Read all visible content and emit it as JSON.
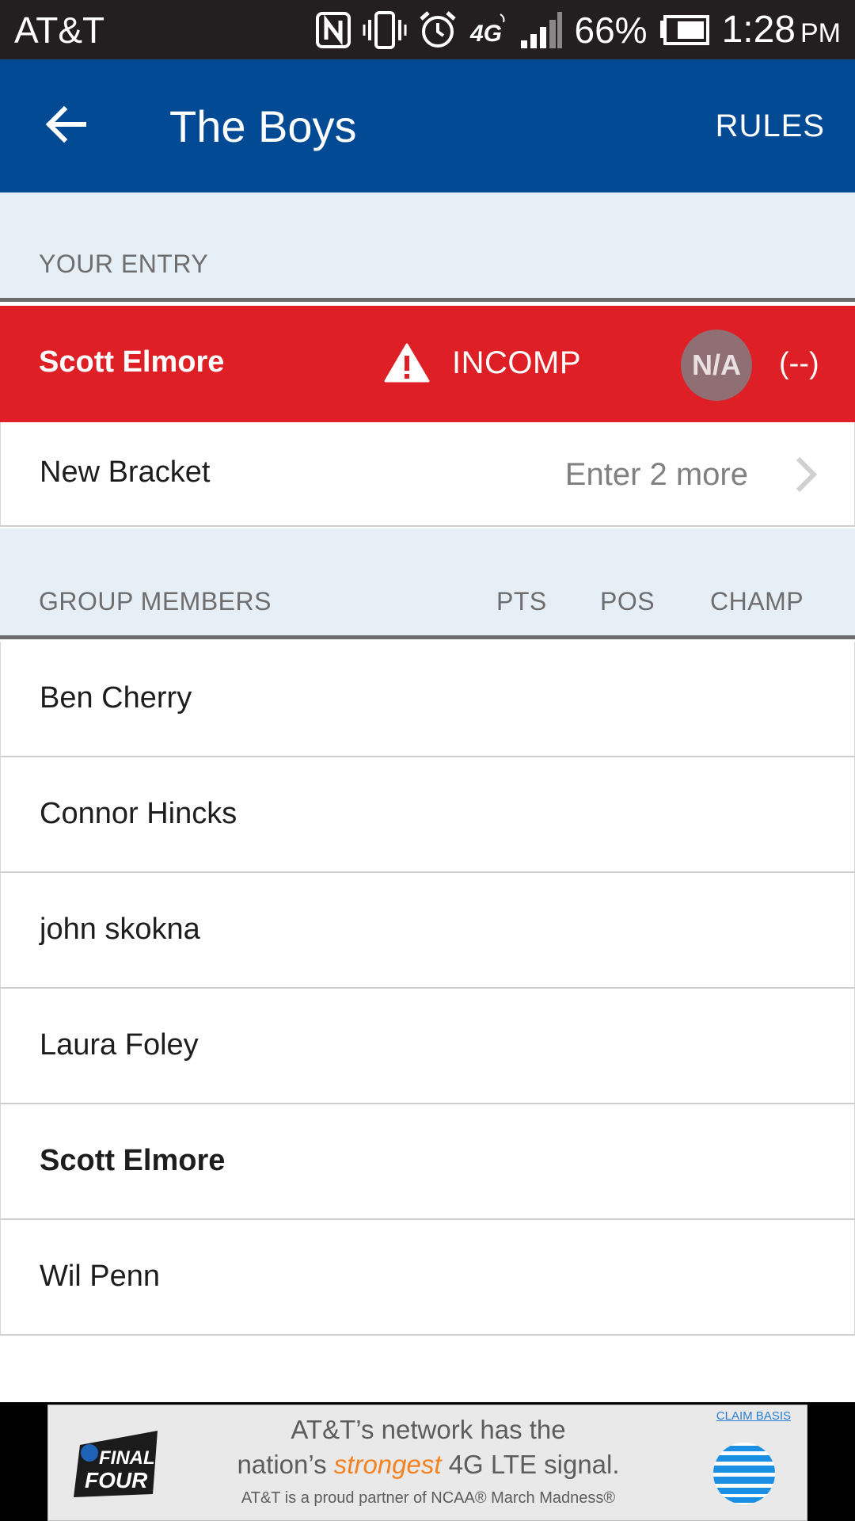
{
  "status_bar": {
    "carrier": "AT&T",
    "network": "4G",
    "battery": "66%",
    "time": "1:28",
    "ampm": "PM"
  },
  "app_bar": {
    "title": "The Boys",
    "rules_label": "RULES"
  },
  "your_entry": {
    "section_label": "YOUR ENTRY",
    "name": "Scott Elmore",
    "status": "INCOMP",
    "badge": "N/A",
    "rank": "(--)",
    "bracket_label": "New Bracket",
    "bracket_cta": "Enter 2 more",
    "colors": {
      "row_bg": "#df1f26",
      "badge_bg": "#8f6f73"
    }
  },
  "group_members": {
    "section_label": "GROUP MEMBERS",
    "columns": [
      "PTS",
      "POS",
      "CHAMP"
    ],
    "members": [
      {
        "name": "Ben Cherry"
      },
      {
        "name": "Connor Hincks"
      },
      {
        "name": "john skokna"
      },
      {
        "name": "Laura Foley"
      },
      {
        "name": "Scott Elmore"
      },
      {
        "name": "Wil Penn"
      }
    ]
  },
  "ad": {
    "line1": "AT&T’s network has the",
    "line2_pre": "nation’s",
    "line2_accent": "strongest",
    "line2_post": "4G LTE signal.",
    "line3": "AT&T is a proud partner of NCAA® March Madness®",
    "claim": "CLAIM BASIS",
    "logo_text": "FINAL FOUR",
    "colors": {
      "accent": "#f58220",
      "globe": "#1a8fe3"
    }
  },
  "colors": {
    "app_bar": "#024a93",
    "status_bar": "#231f20",
    "section_bg": "#e6eef6"
  }
}
